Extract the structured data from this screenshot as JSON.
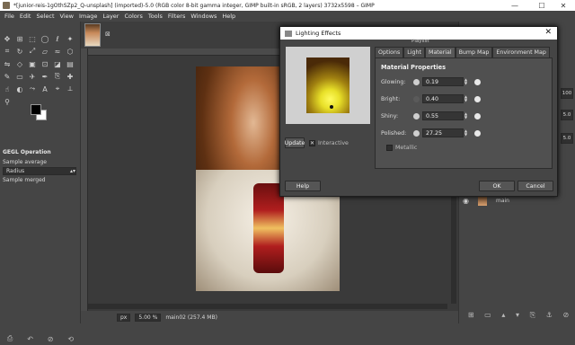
{
  "window": {
    "title": "*[junior-reis-1gOthSZp2_Q-unsplash] (imported)-5.0 (RGB color 8-bit gamma integer, GIMP built-in sRGB, 2 layers) 3732x5598 – GIMP",
    "minimize": "—",
    "maximize": "☐",
    "close": "✕"
  },
  "menu": [
    "File",
    "Edit",
    "Select",
    "View",
    "Image",
    "Layer",
    "Colors",
    "Tools",
    "Filters",
    "Windows",
    "Help"
  ],
  "tool_options": {
    "header": "GEGL Operation",
    "sample_average": "Sample average",
    "radius": "Radius",
    "sample_merged": "Sample merged"
  },
  "image_tab": {
    "close": "⊠"
  },
  "statusbar": {
    "unit": "px",
    "zoom": "5.00 %",
    "layer_info": "main02 (257.4 MB)"
  },
  "right_dock": {
    "values": [
      "100",
      "5.0",
      "5.0"
    ],
    "layer_name": "main"
  },
  "dialog": {
    "title": "Lighting Effects",
    "close": "✕",
    "floating_label": "Playlist",
    "tabs": [
      "Options",
      "Light",
      "Material",
      "Bump Map",
      "Environment Map"
    ],
    "active_tab": "Material",
    "section": "Material Properties",
    "properties": [
      {
        "label": "Glowing:",
        "value": "0.19"
      },
      {
        "label": "Bright:",
        "value": "0.40"
      },
      {
        "label": "Shiny:",
        "value": "0.55"
      },
      {
        "label": "Polished:",
        "value": "27.25"
      }
    ],
    "metallic_label": "Metallic",
    "update_label": "Update",
    "interactive_label": "Interactive",
    "help_label": "Help",
    "ok_label": "OK",
    "cancel_label": "Cancel"
  }
}
